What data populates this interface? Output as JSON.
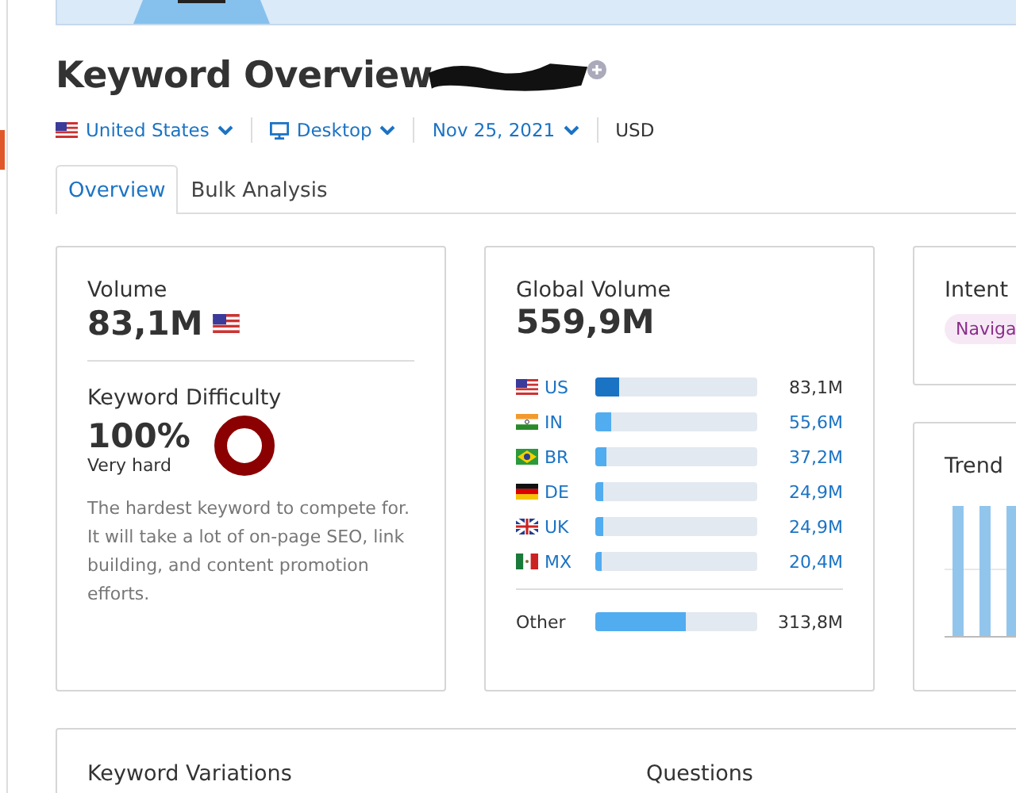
{
  "header": {
    "title": "Keyword Overview"
  },
  "filters": [
    {
      "kind": "country",
      "label": "United States"
    },
    {
      "kind": "device",
      "label": "Desktop"
    },
    {
      "kind": "date",
      "label": "Nov 25, 2021"
    },
    {
      "kind": "currency",
      "label": "USD"
    }
  ],
  "tabs": [
    {
      "label": "Overview",
      "selected": true
    },
    {
      "label": "Bulk Analysis",
      "selected": false
    }
  ],
  "volume": {
    "title": "Volume",
    "value": "83,1M"
  },
  "difficulty": {
    "title": "Keyword Difficulty",
    "value": "100%",
    "level": 1,
    "rating": "Very hard",
    "description": "The hardest keyword to compete for. It will take a lot of on-page SEO, link building, and content promotion efforts."
  },
  "global_volume": {
    "title": "Global Volume",
    "value": "559,9M",
    "rows": [
      {
        "code": "US",
        "level": 0.15,
        "value": "83,1M",
        "selected": true
      },
      {
        "code": "IN",
        "level": 0.1,
        "value": "55,6M",
        "selected": false
      },
      {
        "code": "BR",
        "level": 0.07,
        "value": "37,2M",
        "selected": false
      },
      {
        "code": "DE",
        "level": 0.05,
        "value": "24,9M",
        "selected": false
      },
      {
        "code": "UK",
        "level": 0.05,
        "value": "24,9M",
        "selected": false
      },
      {
        "code": "MX",
        "level": 0.04,
        "value": "20,4M",
        "selected": false
      }
    ],
    "other": {
      "label": "Other",
      "level": 0.56,
      "value": "313,8M"
    }
  },
  "intent": {
    "title": "Intent",
    "tag": "Naviga"
  },
  "trend": {
    "title": "Trend"
  },
  "bottom": {
    "left_title": "Keyword Variations",
    "right_title": "Questions"
  }
}
